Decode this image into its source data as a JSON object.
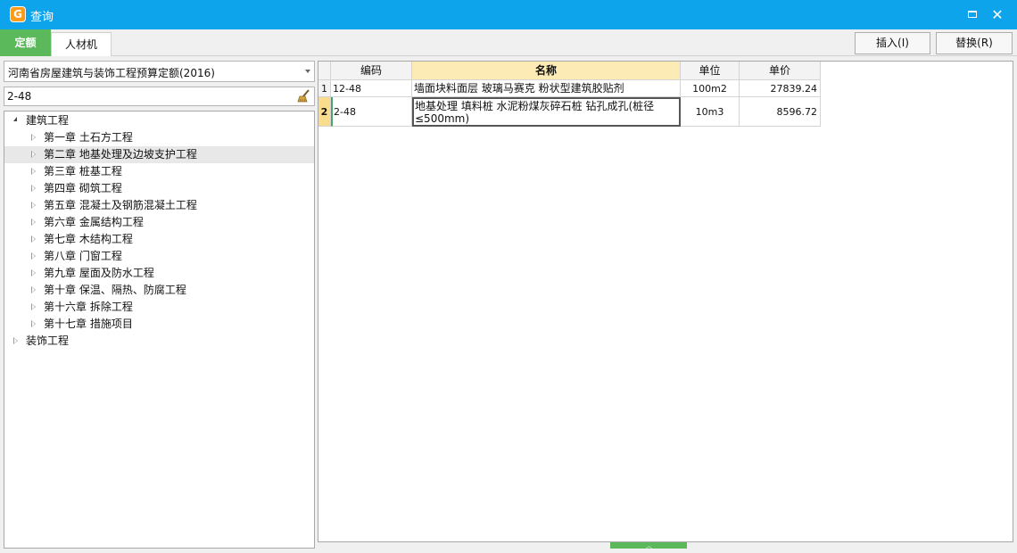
{
  "window": {
    "title": "查询",
    "app_icon": "glodon-app-icon",
    "maximize_icon": "maximize-icon",
    "close_icon": "close-icon",
    "close_glyph": "✕"
  },
  "tabs": {
    "quota": "定额",
    "materials": "人材机"
  },
  "toolbar": {
    "insert_label": "插入(I)",
    "replace_label": "替换(R)"
  },
  "left": {
    "quota_library": "河南省房屋建筑与装饰工程预算定额(2016)",
    "search_value": "2-48",
    "search_clear_icon": "broom-icon",
    "tree": [
      {
        "label": "建筑工程",
        "level": 0,
        "expanded": true
      },
      {
        "label": "第一章 土石方工程",
        "level": 1
      },
      {
        "label": "第二章 地基处理及边坡支护工程",
        "level": 1,
        "selected": true
      },
      {
        "label": "第三章 桩基工程",
        "level": 1
      },
      {
        "label": "第四章 砌筑工程",
        "level": 1
      },
      {
        "label": "第五章 混凝土及钢筋混凝土工程",
        "level": 1
      },
      {
        "label": "第六章 金属结构工程",
        "level": 1
      },
      {
        "label": "第七章 木结构工程",
        "level": 1
      },
      {
        "label": "第八章 门窗工程",
        "level": 1
      },
      {
        "label": "第九章 屋面及防水工程",
        "level": 1
      },
      {
        "label": "第十章 保温、隔热、防腐工程",
        "level": 1
      },
      {
        "label": "第十六章 拆除工程",
        "level": 1
      },
      {
        "label": "第十七章 措施项目",
        "level": 1
      },
      {
        "label": "装饰工程",
        "level": 0,
        "expanded": false
      }
    ]
  },
  "table": {
    "headers": {
      "code": "编码",
      "name": "名称",
      "unit": "单位",
      "price": "单价"
    },
    "rows": [
      {
        "no": "1",
        "code": "12-48",
        "name": "墙面块料面层 玻璃马赛克 粉状型建筑胶贴剂",
        "unit": "100m2",
        "price": "27839.24"
      },
      {
        "no": "2",
        "code": "2-48",
        "name": "地基处理 填料桩 水泥粉煤灰碎石桩 钻孔成孔(桩径≤500mm)",
        "unit": "10m3",
        "price": "8596.72"
      }
    ]
  },
  "colors": {
    "titlebar": "#0ea4ec",
    "active_tab": "#5bb95b",
    "name_header": "#fcebb4",
    "current_row": "#f9dd8c"
  }
}
